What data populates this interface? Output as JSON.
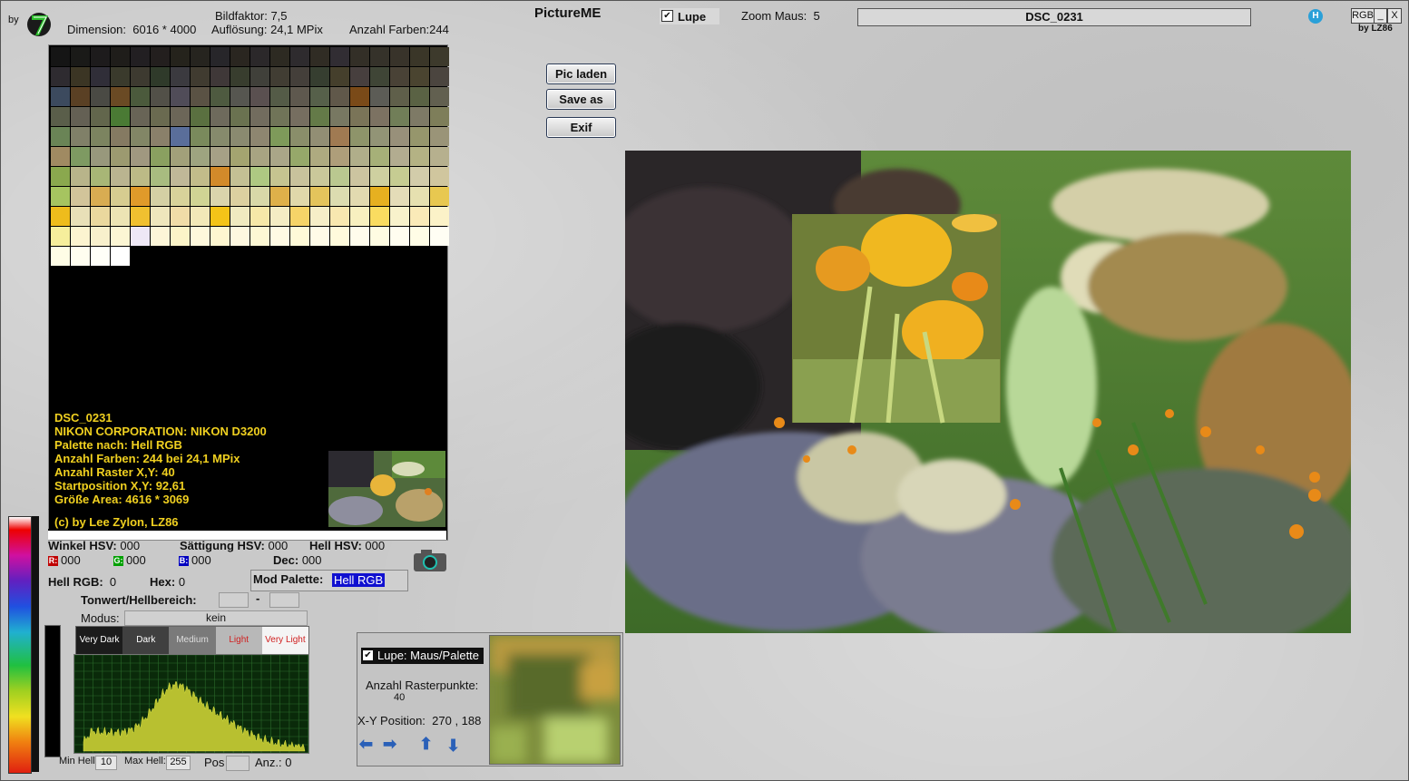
{
  "header": {
    "by_label": "by",
    "dimension_label": "Dimension:",
    "dimension_value": "6016 * 4000",
    "bildfaktor_label": "Bildfaktor:",
    "bildfaktor_value": "7,5",
    "aufloesung_label": "Auflösung:",
    "aufloesung_value": "24,1 MPix",
    "anzahl_farben_label": "Anzahl Farben:",
    "anzahl_farben_value": "244",
    "app_title": "PictureME",
    "lupe_label": "Lupe",
    "zoom_label": "Zoom Maus:",
    "zoom_value": "5",
    "file_title": "DSC_0231",
    "rgb_button": "RGB",
    "minimize": "_",
    "close": "X",
    "by_lz86": "by LZ86"
  },
  "buttons": {
    "pic_laden": "Pic laden",
    "save_as": "Save as",
    "exif": "Exif"
  },
  "info": {
    "line1": "DSC_0231",
    "line2": "NIKON CORPORATION: NIKON D3200",
    "line3": "Palette nach: Hell RGB",
    "line4": "Anzahl Farben: 244  bei 24,1 MPix",
    "line5": "Anzahl Raster X,Y: 40",
    "line6": "Startposition X,Y: 92,61",
    "line7": "Größe Area: 4616 * 3069",
    "line8": "(c) by Lee Zylon, LZ86"
  },
  "hsv": {
    "winkel_label": "Winkel HSV:",
    "winkel_value": "000",
    "saettigung_label": "Sättigung HSV:",
    "saettigung_value": "000",
    "hell_label": "Hell HSV:",
    "hell_value": "000",
    "r_label": "R:",
    "r_value": "000",
    "g_label": "G:",
    "g_value": "000",
    "b_label": "B:",
    "b_value": "000",
    "dec_label": "Dec:",
    "dec_value": "000",
    "hell_rgb_label": "Hell RGB:",
    "hell_rgb_value": "0",
    "hex_label": "Hex:",
    "hex_value": "0",
    "mod_palette_label": "Mod Palette:",
    "mod_palette_value": "Hell RGB"
  },
  "tonwert": {
    "label": "Tonwert/Hellbereich:",
    "dash": "-",
    "modus_label": "Modus:",
    "modus_value": "kein",
    "bands": [
      "Very Dark",
      "Dark",
      "Medium",
      "Light",
      "Very Light"
    ]
  },
  "histogram_footer": {
    "min_hell_label": "Min Hell:",
    "min_hell_value": "10",
    "max_hell_label": "Max Hell:",
    "max_hell_value": "255",
    "pos_label": "Pos",
    "anz_label": "Anz.:",
    "anz_value": "0"
  },
  "lupe_panel": {
    "checkbox_label": "Lupe: Maus/Palette",
    "rasterpunkte_label": "Anzahl Rasterpunkte:",
    "rasterpunkte_value": "40",
    "xy_label": "X-Y Position:",
    "xy_value": "270 , 188"
  },
  "colors": {
    "info_text": "#f0d020",
    "mod_palette_bg": "#1010d0",
    "red_box": "#c00000",
    "green_box": "#00a000",
    "blue_box": "#0000c0"
  },
  "icons": [
    "camera-icon",
    "arrow-left-icon",
    "arrow-right-icon",
    "arrow-up-icon",
    "arrow-down-icon",
    "logo-icon",
    "help-icon"
  ]
}
